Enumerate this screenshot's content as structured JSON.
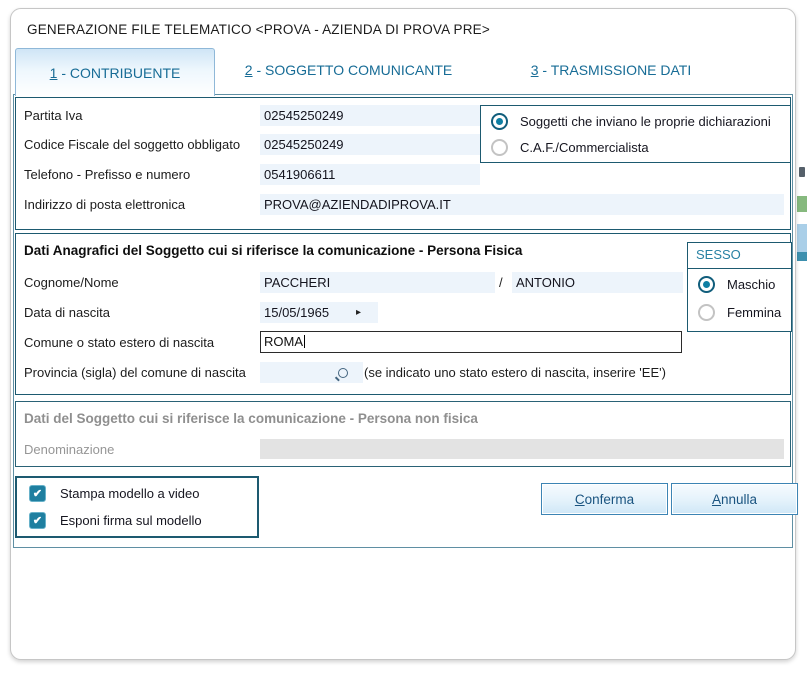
{
  "window": {
    "title": "GENERAZIONE FILE TELEMATICO <PROVA - AZIENDA DI PROVA PRE>"
  },
  "tabs": {
    "tab1": {
      "num": "1",
      "rest": " - CONTRIBUENTE",
      "active": true
    },
    "tab2": {
      "num": "2",
      "rest": " - SOGGETTO COMUNICANTE",
      "active": false
    },
    "tab3": {
      "num": "3",
      "rest": " - TRASMISSIONE DATI",
      "active": false
    }
  },
  "contribuente": {
    "fields": [
      {
        "label": "Partita Iva",
        "value": "02545250249"
      },
      {
        "label": "Codice Fiscale del soggetto obbligato",
        "value": "02545250249"
      },
      {
        "label": "Telefono - Prefisso e numero",
        "value": "0541906611"
      },
      {
        "label": "Indirizzo di posta elettronica",
        "value": "PROVA@AZIENDADIPROVA.IT"
      }
    ],
    "sender_type": {
      "options": [
        {
          "label": "Soggetti che inviano le proprie dichiarazioni",
          "selected": true
        },
        {
          "label": "C.A.F./Commercialista",
          "selected": false
        }
      ]
    }
  },
  "persona_fisica": {
    "title": "Dati Anagrafici del Soggetto cui si riferisce la comunicazione - Persona Fisica",
    "cognome_label": "Cognome/Nome",
    "cognome": "PACCHERI",
    "separator": "/",
    "nome": "ANTONIO",
    "nascita_label": "Data di nascita",
    "nascita": "15/05/1965",
    "comune_label": "Comune o stato estero di nascita",
    "comune": "ROMA",
    "provincia_label": "Provincia (sigla) del comune di nascita",
    "provincia": "",
    "provincia_hint": "(se indicato uno stato estero di nascita, inserire 'EE')",
    "sesso": {
      "title": "SESSO",
      "options": [
        {
          "label": "Maschio",
          "selected": true
        },
        {
          "label": "Femmina",
          "selected": false
        }
      ]
    }
  },
  "persona_non_fisica": {
    "title": "Dati del Soggetto cui si riferisce la comunicazione - Persona non fisica",
    "denominazione_label": "Denominazione",
    "denominazione": ""
  },
  "print_options": [
    {
      "label": "Stampa modello a video",
      "checked": true
    },
    {
      "label": "Esponi firma sul modello",
      "checked": true
    }
  ],
  "buttons": {
    "conferma_accel": "C",
    "conferma_rest": "onferma",
    "annulla_accel": "A",
    "annulla_rest": "nnulla"
  },
  "colors": {
    "accent_border": "#1d5a70",
    "control_teal": "#1f7fa0",
    "tab_text": "#176c96",
    "field_bg": "#edf4fb",
    "disabled_bg": "#e3e3e3"
  }
}
